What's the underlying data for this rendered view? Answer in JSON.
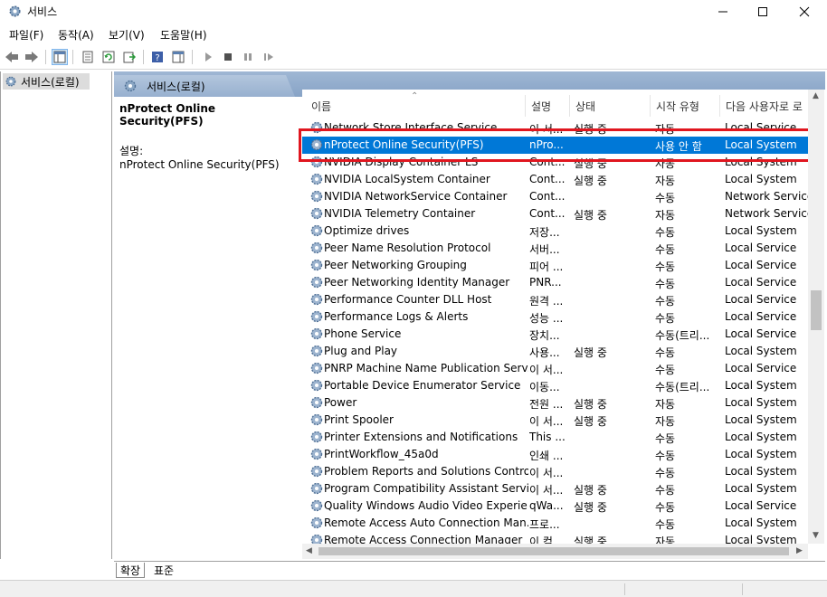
{
  "window": {
    "title": "서비스",
    "controls": [
      "minimize-icon",
      "maximize-icon",
      "close-icon"
    ]
  },
  "menu": [
    "파일(F)",
    "동작(A)",
    "보기(V)",
    "도움말(H)"
  ],
  "toolbar": [
    "back-arrow-icon",
    "forward-arrow-icon",
    "console-tree-icon",
    "properties-icon",
    "refresh-icon",
    "export-list-icon",
    "help-icon",
    "show-hide-icon",
    "start-service-icon",
    "stop-service-icon",
    "pause-service-icon",
    "restart-service-icon"
  ],
  "left_pane": {
    "node_label": "서비스(로컬)"
  },
  "right_pane": {
    "header_title": "서비스(로컬)",
    "selected_name": "nProtect Online Security(PFS)",
    "description_label": "설명:",
    "description_value": "nProtect Online Security(PFS)"
  },
  "columns": [
    "이름",
    "설명",
    "상태",
    "시작 유형",
    "다음 사용자로 로"
  ],
  "rows": [
    {
      "name": "Network Store Interface Service",
      "desc": "이 서...",
      "status": "실행 중",
      "startup": "자동",
      "logon": "Local Service"
    },
    {
      "name": "nProtect Online Security(PFS)",
      "desc": "nPro...",
      "status": "",
      "startup": "사용 안 함",
      "logon": "Local System"
    },
    {
      "name": "NVIDIA Display Container LS",
      "desc": "Cont...",
      "status": "실행 중",
      "startup": "자동",
      "logon": "Local System"
    },
    {
      "name": "NVIDIA LocalSystem Container",
      "desc": "Cont...",
      "status": "실행 중",
      "startup": "자동",
      "logon": "Local System"
    },
    {
      "name": "NVIDIA NetworkService Container",
      "desc": "Cont...",
      "status": "",
      "startup": "수동",
      "logon": "Network Service"
    },
    {
      "name": "NVIDIA Telemetry Container",
      "desc": "Cont...",
      "status": "실행 중",
      "startup": "자동",
      "logon": "Network Service"
    },
    {
      "name": "Optimize drives",
      "desc": "저장...",
      "status": "",
      "startup": "수동",
      "logon": "Local System"
    },
    {
      "name": "Peer Name Resolution Protocol",
      "desc": "서버...",
      "status": "",
      "startup": "수동",
      "logon": "Local Service"
    },
    {
      "name": "Peer Networking Grouping",
      "desc": "피어 ...",
      "status": "",
      "startup": "수동",
      "logon": "Local Service"
    },
    {
      "name": "Peer Networking Identity Manager",
      "desc": "PNR...",
      "status": "",
      "startup": "수동",
      "logon": "Local Service"
    },
    {
      "name": "Performance Counter DLL Host",
      "desc": "원격 ...",
      "status": "",
      "startup": "수동",
      "logon": "Local Service"
    },
    {
      "name": "Performance Logs & Alerts",
      "desc": "성능 ...",
      "status": "",
      "startup": "수동",
      "logon": "Local Service"
    },
    {
      "name": "Phone Service",
      "desc": "장치...",
      "status": "",
      "startup": "수동(트리...",
      "logon": "Local Service"
    },
    {
      "name": "Plug and Play",
      "desc": "사용...",
      "status": "실행 중",
      "startup": "수동",
      "logon": "Local System"
    },
    {
      "name": "PNRP Machine Name Publication Serv...",
      "desc": "이 서...",
      "status": "",
      "startup": "수동",
      "logon": "Local Service"
    },
    {
      "name": "Portable Device Enumerator Service",
      "desc": "이동...",
      "status": "",
      "startup": "수동(트리...",
      "logon": "Local System"
    },
    {
      "name": "Power",
      "desc": "전원 ...",
      "status": "실행 중",
      "startup": "자동",
      "logon": "Local System"
    },
    {
      "name": "Print Spooler",
      "desc": "이 서...",
      "status": "실행 중",
      "startup": "자동",
      "logon": "Local System"
    },
    {
      "name": "Printer Extensions and Notifications",
      "desc": "This ...",
      "status": "",
      "startup": "수동",
      "logon": "Local System"
    },
    {
      "name": "PrintWorkflow_45a0d",
      "desc": "인쇄 ...",
      "status": "",
      "startup": "수동",
      "logon": "Local System"
    },
    {
      "name": "Problem Reports and Solutions Contro...",
      "desc": "이 서...",
      "status": "",
      "startup": "수동",
      "logon": "Local System"
    },
    {
      "name": "Program Compatibility Assistant Service",
      "desc": "이 서...",
      "status": "실행 중",
      "startup": "수동",
      "logon": "Local System"
    },
    {
      "name": "Quality Windows Audio Video Experie...",
      "desc": "qWa...",
      "status": "실행 중",
      "startup": "수동",
      "logon": "Local Service"
    },
    {
      "name": "Remote Access Auto Connection Man...",
      "desc": "프로...",
      "status": "",
      "startup": "수동",
      "logon": "Local System"
    },
    {
      "name": "Remote Access Connection Manager",
      "desc": "이 컴...",
      "status": "실행 중",
      "startup": "자동",
      "logon": "Local System"
    }
  ],
  "selected_row_index": 1,
  "bottom_tabs": [
    "확장",
    "표준"
  ],
  "colors": {
    "selection": "#0078d7",
    "highlight_box": "#e0161f",
    "header_gradient": "#9fb7d4"
  }
}
